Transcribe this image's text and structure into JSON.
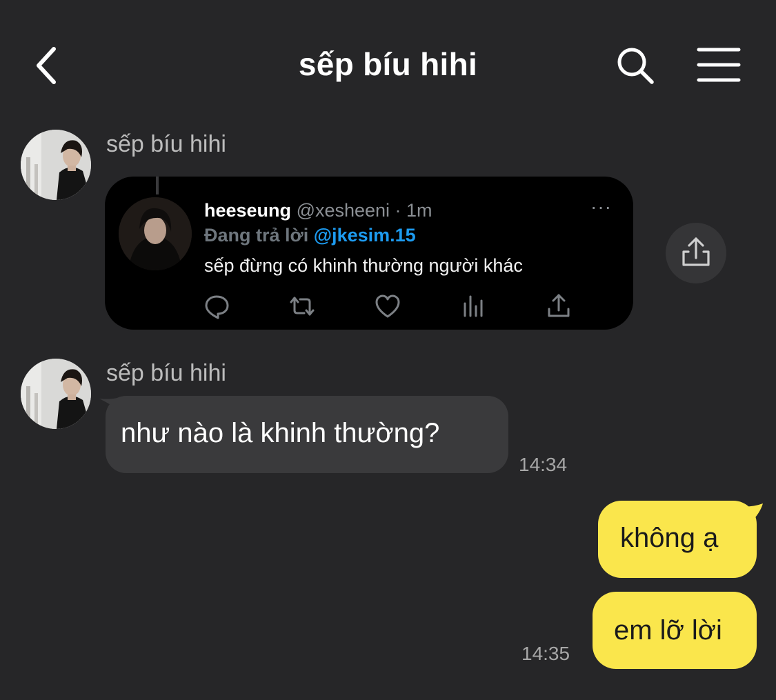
{
  "header": {
    "title": "sếp bíu hihi"
  },
  "messages": {
    "m1": {
      "sender": "sếp bíu hihi"
    },
    "tweet": {
      "name": "heeseung",
      "handle": "@xesheeni · 1m",
      "reply_label": "Đang trả lời",
      "reply_mention": "@jkesim.15",
      "text": "sếp đừng có khinh thường người khác",
      "more": "···"
    },
    "m2": {
      "sender": "sếp bíu hihi",
      "text": "như nào là khinh thường?",
      "time": "14:34"
    },
    "m3": {
      "text": "không ạ"
    },
    "m4": {
      "text": "em lỡ lời",
      "time": "14:35"
    }
  },
  "colors": {
    "background": "#262628",
    "incoming_bubble": "#3a3a3c",
    "outgoing_bubble": "#fae64c",
    "twitter_blue": "#1d9bf0"
  },
  "icons": [
    "back-chevron-icon",
    "search-icon",
    "menu-icon",
    "share-icon",
    "reply-icon",
    "retweet-icon",
    "like-icon",
    "analytics-icon",
    "tweet-share-icon",
    "more-icon"
  ]
}
